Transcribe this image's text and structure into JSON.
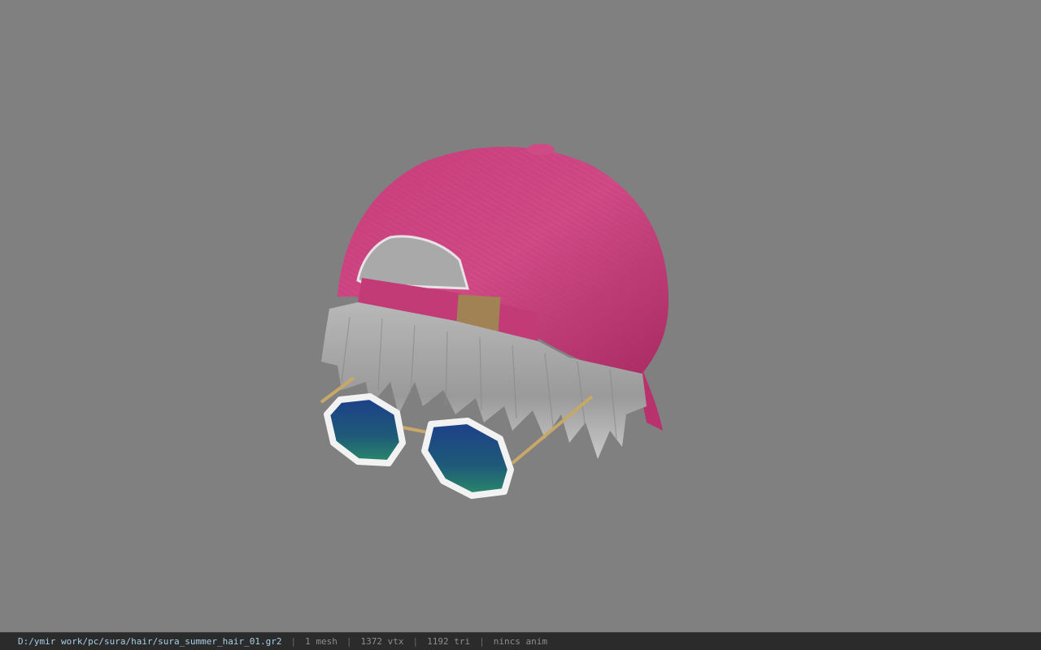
{
  "viewport": {
    "model_name": "sura_summer_hair_01",
    "background_color": "#808080"
  },
  "status_bar": {
    "file_path": "D:/ymir work/pc/sura/hair/sura_summer_hair_01.gr2",
    "separator": "|",
    "mesh_count": "1 mesh",
    "vertex_count": "1372 vtx",
    "triangle_count": "1192 tri",
    "animation": "nincs anim"
  }
}
